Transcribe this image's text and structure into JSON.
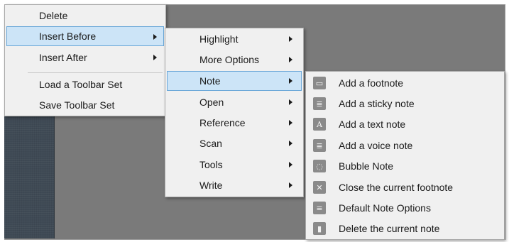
{
  "context_menu": {
    "items": [
      {
        "label": "Delete"
      },
      {
        "label": "Insert Before"
      },
      {
        "label": "Insert After"
      },
      {
        "label": "Load a Toolbar Set"
      },
      {
        "label": "Save Toolbar Set"
      }
    ]
  },
  "insert_before_submenu": {
    "items": [
      {
        "label": "Highlight"
      },
      {
        "label": "More Options"
      },
      {
        "label": "Note"
      },
      {
        "label": "Open"
      },
      {
        "label": "Reference"
      },
      {
        "label": "Scan"
      },
      {
        "label": "Tools"
      },
      {
        "label": "Write"
      }
    ]
  },
  "note_submenu": {
    "items": [
      {
        "label": "Add a footnote",
        "icon": "footnote-icon",
        "glyph": "▭"
      },
      {
        "label": "Add a sticky note",
        "icon": "sticky-note-icon",
        "glyph": "≣"
      },
      {
        "label": "Add a text note",
        "icon": "text-note-icon",
        "glyph": "A"
      },
      {
        "label": "Add a voice note",
        "icon": "voice-note-icon",
        "glyph": "≣"
      },
      {
        "label": "Bubble Note",
        "icon": "bubble-note-icon",
        "glyph": "◌"
      },
      {
        "label": "Close the current footnote",
        "icon": "close-footnote-icon",
        "glyph": "✕"
      },
      {
        "label": "Default Note Options",
        "icon": "note-options-icon",
        "glyph": "≡"
      },
      {
        "label": "Delete the current note",
        "icon": "delete-note-icon",
        "glyph": "▮"
      }
    ]
  },
  "colors": {
    "menu_bg": "#f0f0f0",
    "selection_bg": "#cce4f7",
    "selection_border": "#6aa7d8",
    "background": "#7a7a7a"
  }
}
